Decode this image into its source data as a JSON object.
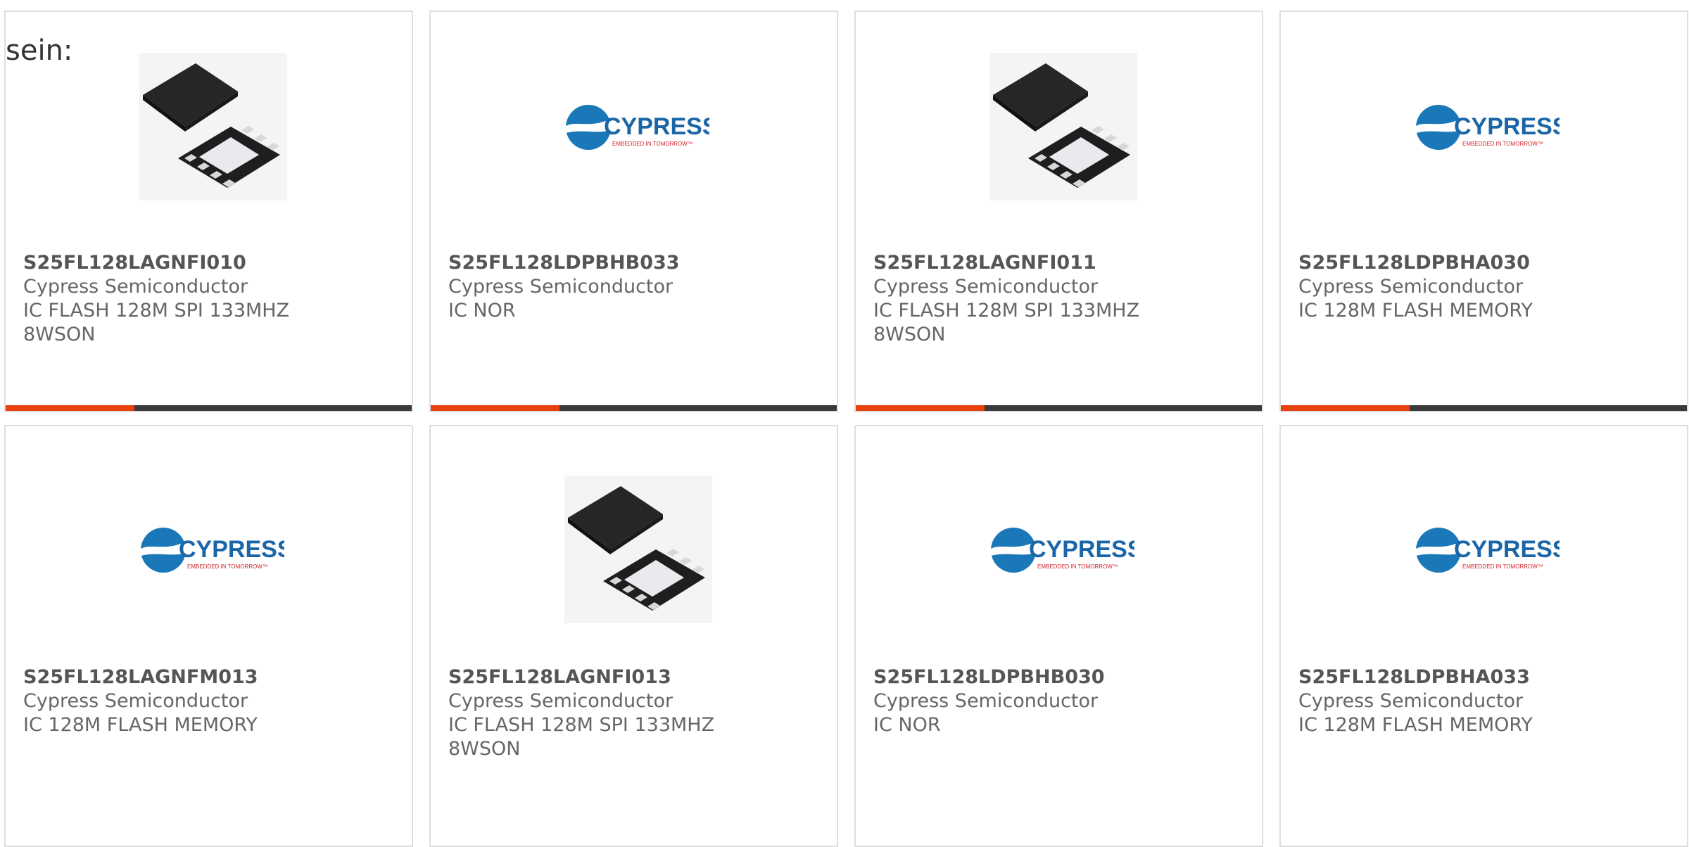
{
  "lead_text": "sein:",
  "colors": {
    "accent": "#e8410f",
    "bar": "#3a3a3a",
    "logo_blue": "#1a78b8",
    "logo_text": "#1a66a8",
    "logo_red": "#d2232a"
  },
  "logo": {
    "name": "CYPRESS",
    "tagline": "EMBEDDED IN TOMORROW™"
  },
  "cards": [
    {
      "part_number": "S25FL128LAGNFI010",
      "manufacturer": "Cypress Semiconductor",
      "description": "IC FLASH 128M SPI 133MHZ 8WSON",
      "image": "chip-package-icon"
    },
    {
      "part_number": "S25FL128LDPBHB033",
      "manufacturer": "Cypress Semiconductor",
      "description": "IC NOR",
      "image": "cypress-logo"
    },
    {
      "part_number": "S25FL128LAGNFI011",
      "manufacturer": "Cypress Semiconductor",
      "description": "IC FLASH 128M SPI 133MHZ 8WSON",
      "image": "chip-package-icon"
    },
    {
      "part_number": "S25FL128LDPBHA030",
      "manufacturer": "Cypress Semiconductor",
      "description": "IC 128M FLASH MEMORY",
      "image": "cypress-logo"
    },
    {
      "part_number": "S25FL128LAGNFM013",
      "manufacturer": "Cypress Semiconductor",
      "description": "IC 128M FLASH MEMORY",
      "image": "cypress-logo"
    },
    {
      "part_number": "S25FL128LAGNFI013",
      "manufacturer": "Cypress Semiconductor",
      "description": "IC FLASH 128M SPI 133MHZ 8WSON",
      "image": "chip-package-icon"
    },
    {
      "part_number": "S25FL128LDPBHB030",
      "manufacturer": "Cypress Semiconductor",
      "description": "IC NOR",
      "image": "cypress-logo"
    },
    {
      "part_number": "S25FL128LDPBHA033",
      "manufacturer": "Cypress Semiconductor",
      "description": "IC 128M FLASH MEMORY",
      "image": "cypress-logo"
    }
  ]
}
